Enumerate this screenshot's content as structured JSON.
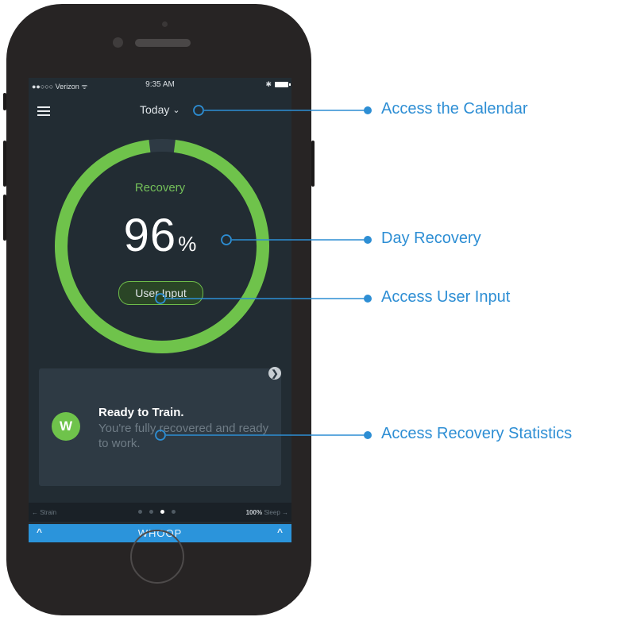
{
  "status_bar": {
    "carrier": "●●○○○ Verizon ᯤ",
    "time": "9:35 AM",
    "bluetooth": "✱"
  },
  "header": {
    "date_selector": "Today",
    "chevron": "⌄"
  },
  "recovery": {
    "label": "Recovery",
    "value": "96",
    "unit": "%",
    "value_fraction": 0.96,
    "user_input_label": "User Input"
  },
  "card": {
    "icon_letter": "W",
    "title": "Ready to Train.",
    "text": "You're fully recovered and ready to work.",
    "expand_glyph": "❯"
  },
  "bottom_nav": {
    "left": "← Strain",
    "right_value": "100%",
    "right_label": "Sleep →",
    "dot_count": 4,
    "active_dot": 2
  },
  "whoop_bar": {
    "label": "WHOOP",
    "chevron": "^"
  },
  "annotations": [
    {
      "label": "Access the Calendar"
    },
    {
      "label": "Day Recovery"
    },
    {
      "label": "Access User Input"
    },
    {
      "label": "Access Recovery Statistics"
    }
  ],
  "colors": {
    "accent_green": "#6fc34b",
    "annotation_blue": "#2d8ed4",
    "whoop_blue": "#2b94db",
    "screen_bg": "#222c33"
  }
}
